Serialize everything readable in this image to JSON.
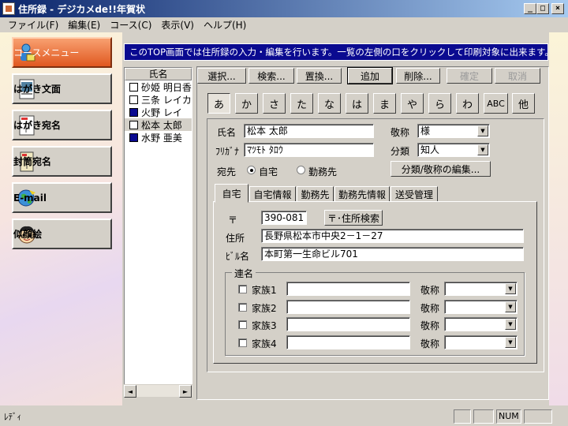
{
  "window": {
    "title": "住所録 - デジカメde!!年賀状",
    "min_glyph": "_",
    "max_glyph": "□",
    "close_glyph": "×"
  },
  "menu": [
    "ファイル(F)",
    "編集(E)",
    "コース(C)",
    "表示(V)",
    "ヘルプ(H)"
  ],
  "nav": {
    "course": "コースメニュー",
    "hagaki_bun": "はがき文面",
    "hagaki_ate": "はがき宛名",
    "futo": "封筒宛名",
    "email": "E-mail",
    "nigaoe": "似顔絵"
  },
  "banner": "このTOP画面では住所録の入力・編集を行います。一覧の左側の口をクリックして印刷対象に出来ます。",
  "list": {
    "header": "氏名",
    "rows": [
      {
        "name": "砂姫 明日香",
        "checked": false
      },
      {
        "name": "三条 レイカ",
        "checked": false
      },
      {
        "name": "火野 レイ",
        "checked": true
      },
      {
        "name": "松本 太郎",
        "checked": false
      },
      {
        "name": "水野 亜美",
        "checked": true
      }
    ],
    "scroll_left": "◄",
    "scroll_right": "►"
  },
  "toolbar": {
    "select": "選択...",
    "search": "検索...",
    "replace": "置換...",
    "add": "追加",
    "delete": "削除...",
    "confirm": "確定",
    "cancel": "取消"
  },
  "kana": [
    "あ",
    "か",
    "さ",
    "た",
    "な",
    "は",
    "ま",
    "や",
    "ら",
    "わ",
    "ABC",
    "他"
  ],
  "form": {
    "name_label": "氏名",
    "name_value": "松本 太郎",
    "furigana_label": "ﾌﾘｶﾞﾅ",
    "furigana_value": "ﾏﾂﾓﾄ ﾀﾛｳ",
    "honorific_label": "敬称",
    "honorific_value": "様",
    "category_label": "分類",
    "category_value": "知人",
    "dest_label": "宛先",
    "dest_home": "自宅",
    "dest_work": "勤務先",
    "edit_btn": "分類/敬称の編集..."
  },
  "tabs": [
    "自宅",
    "自宅情報",
    "勤務先",
    "勤務先情報",
    "送受管理"
  ],
  "address": {
    "zip_label": "〒",
    "zip_value": "390-081",
    "zip_btn": "〒･住所検索",
    "addr_label": "住所",
    "addr_value": "長野県松本市中央2－1－27",
    "bldg_label": "ﾋﾞﾙ名",
    "bldg_value": "本町第一生命ビル701"
  },
  "joint": {
    "title": "連名",
    "families": [
      "家族1",
      "家族2",
      "家族3",
      "家族4"
    ],
    "honorific_label": "敬称",
    "dropdown_glyph": "▼"
  },
  "status": {
    "left": "ﾚﾃﾞｨ",
    "num": "NUM"
  }
}
